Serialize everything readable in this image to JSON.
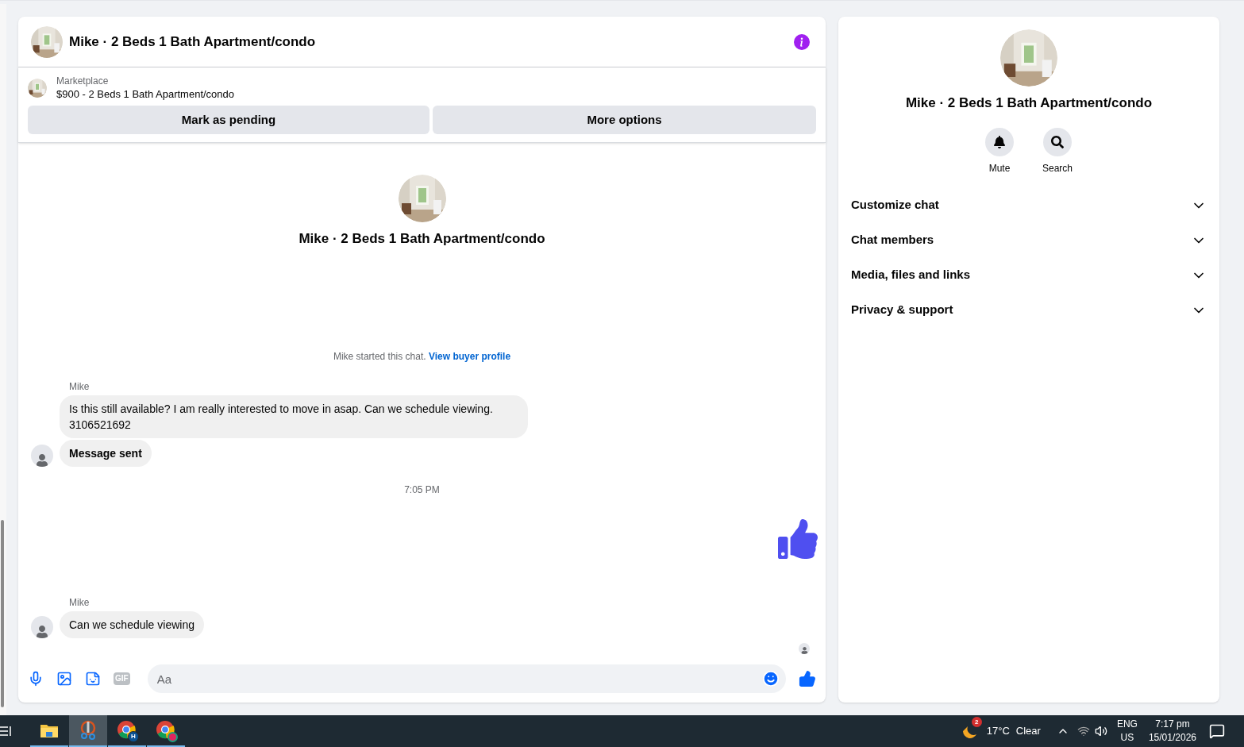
{
  "chat": {
    "title": "Mike · 2 Beds 1 Bath Apartment/condo",
    "listing": {
      "source": "Marketplace",
      "text": "$900 - 2 Beds 1 Bath Apartment/condo"
    },
    "buttons": [
      "Mark as pending",
      "More options"
    ],
    "intro": {
      "title": "Mike · 2 Beds 1 Bath Apartment/condo",
      "notice": "Mike started this chat.",
      "link": "View buyer profile"
    },
    "timeline": [
      {
        "kind": "group",
        "sender": "Mike",
        "bubbles": [
          {
            "kind": "text",
            "text": "Is this still available? I am really interested to move in asap. Can we schedule viewing. 3106521692"
          },
          {
            "kind": "notice",
            "text": "Message sent"
          }
        ]
      },
      {
        "kind": "time",
        "text": "7:05 PM"
      },
      {
        "kind": "like"
      },
      {
        "kind": "group",
        "sender": "Mike",
        "bubbles": [
          {
            "kind": "text",
            "text": "Can we schedule viewing"
          }
        ]
      }
    ],
    "composer": {
      "placeholder": "Aa",
      "gif": "GIF"
    }
  },
  "details": {
    "title": "Mike · 2 Beds 1 Bath Apartment/condo",
    "actions": [
      {
        "kind": "mute",
        "label": "Mute"
      },
      {
        "kind": "search",
        "label": "Search"
      }
    ],
    "sections": [
      {
        "label": "Customize chat",
        "expanded": false
      },
      {
        "label": "Chat members",
        "expanded": false
      },
      {
        "label": "Media, files and links",
        "expanded": false
      },
      {
        "label": "Privacy & support",
        "expanded": false
      }
    ]
  },
  "taskbar": {
    "apps": [
      {
        "kind": "folder",
        "selected": false
      },
      {
        "kind": "snip",
        "selected": true
      },
      {
        "kind": "browser",
        "badge": "H",
        "selected": false
      },
      {
        "kind": "browser-rec",
        "selected": false
      }
    ],
    "weather": {
      "alerts": "2",
      "temp": "17°C",
      "condition": "Clear"
    },
    "lang": "ENG",
    "region": "US",
    "time": "7:17 pm",
    "date": "15/01/2026"
  }
}
